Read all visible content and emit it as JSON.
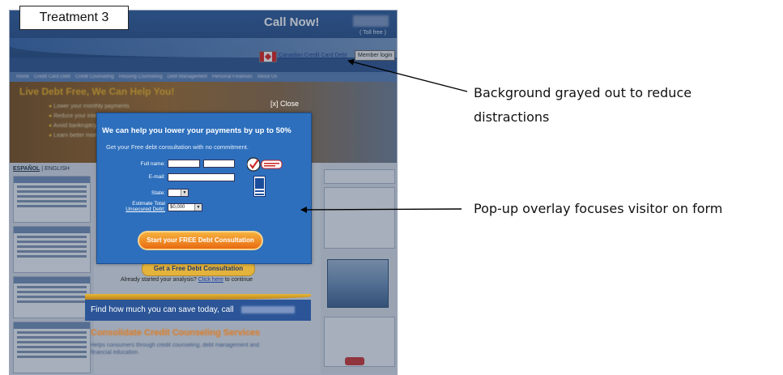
{
  "label": "Treatment 3",
  "site": {
    "call_now": "Call Now!",
    "toll_free": "( Toll free )",
    "canadian_link": "Canadian Credit Card Debt",
    "member_login": "Member login",
    "nav": [
      "Home",
      "Credit Card Debt",
      "Credit Counseling",
      "Housing Counseling",
      "Debt Management",
      "Personal Finances",
      "About Us"
    ],
    "hero_title": "Live Debt Free, We Can Help You!",
    "hero_bullets": [
      "Lower your monthly payments",
      "Reduce your interest rates",
      "Avoid bankruptcy",
      "Learn better money habits"
    ],
    "lang_es": "ESPAÑOL",
    "lang_sep": "|",
    "lang_en": "ENGLISH",
    "get_consult_btn": "Get a Free Debt Consultation",
    "already_prefix": "Already started your analysis?",
    "click_here": "Click here",
    "already_suffix": "to continue",
    "find_text": "Find how much you can save today, call",
    "consolidation_title": "Consolidate Credit Counseling Services",
    "consolidation_sub": "Helps consumers through credit counseling, debt management and financial education."
  },
  "popup": {
    "close": "[x] Close",
    "title": "We can help you lower your payments by up to 50%",
    "subtitle": "Get your Free debt consultation with no commitment.",
    "full_name_label": "Full name:",
    "email_label": "E-mail:",
    "state_label": "State:",
    "estimate_label_1": "Estimate Total",
    "estimate_label_2": "Unsecured Debt:",
    "debt_value": "$0,000",
    "cta": "Start your FREE Debt Consultation"
  },
  "annotations": {
    "background": [
      "Background grayed out to reduce",
      "distractions"
    ],
    "popup": "Pop-up overlay focuses visitor on form"
  },
  "colors": {
    "popup_bg": "#2d6fbd",
    "cta_orange": "#e96b12",
    "overlay": "rgba(40,55,80,0.36)"
  },
  "icons": [
    "canada-flag-icon",
    "verisign-badge-icon",
    "bbb-badge-icon",
    "arrow-icon"
  ]
}
